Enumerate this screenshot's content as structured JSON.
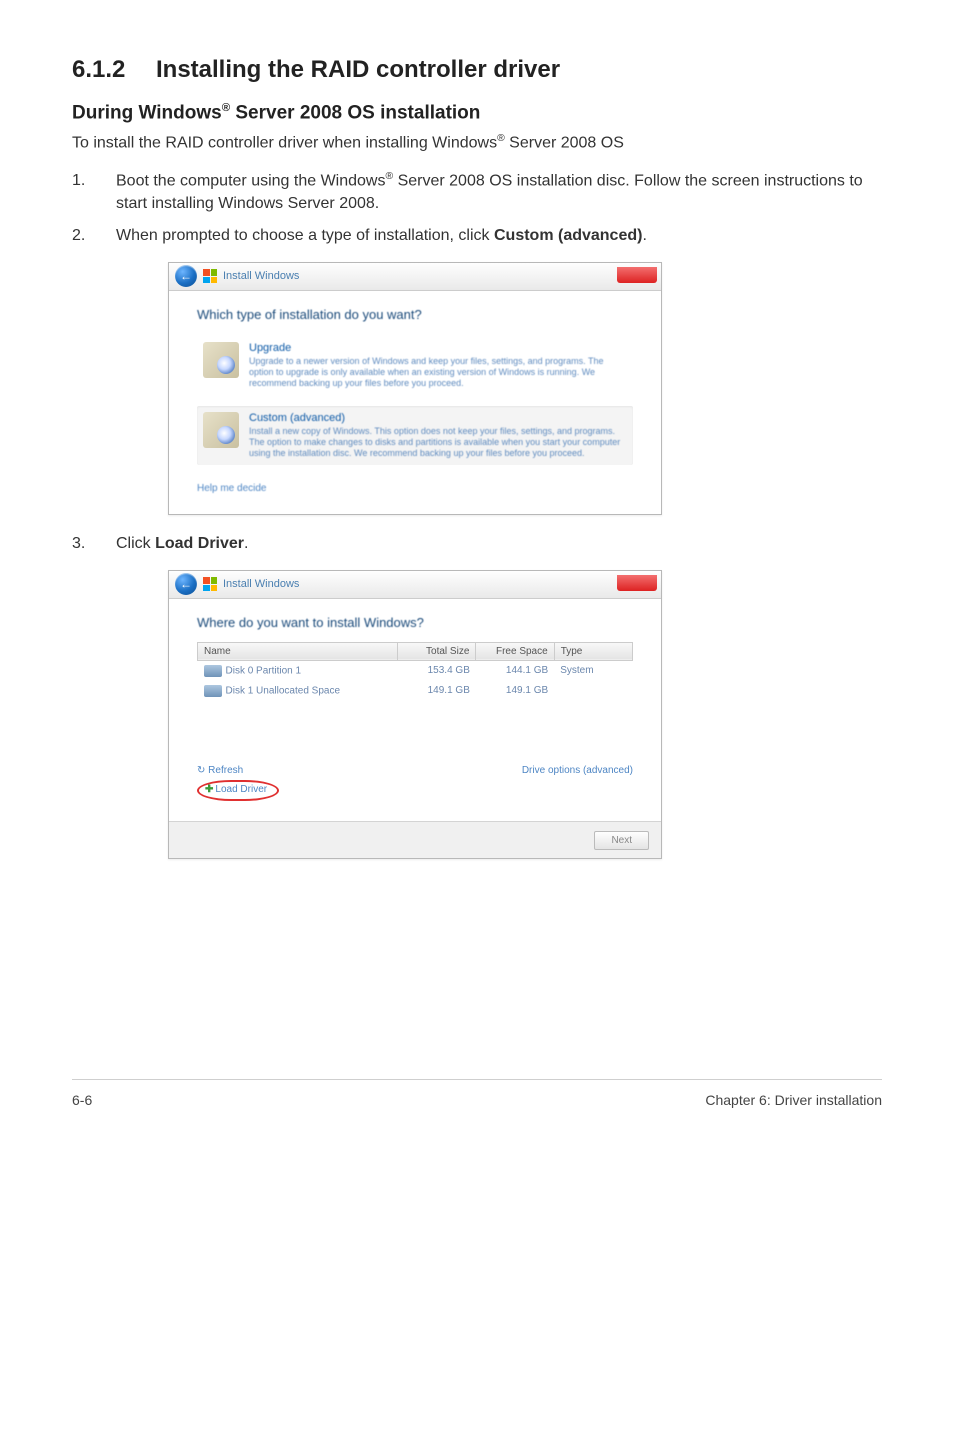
{
  "section": {
    "number": "6.1.2",
    "title": "Installing the RAID controller driver"
  },
  "subsection": {
    "prefix": "During Windows",
    "reg": "®",
    "suffix": " Server 2008 OS installation"
  },
  "intro": {
    "prefix": "To install the RAID controller driver when installing Windows",
    "reg": "®",
    "suffix": " Server 2008 OS"
  },
  "steps": {
    "s1": {
      "num": "1.",
      "line1_prefix": "Boot the computer using the Windows",
      "line1_reg": "®",
      "line1_suffix": " Server 2008 OS installation disc. Follow the screen instructions to start installing Windows Server 2008."
    },
    "s2": {
      "num": "2.",
      "text_prefix": "When prompted to choose a type of installation, click ",
      "bold": "Custom (advanced)",
      "text_suffix": "."
    },
    "s3": {
      "num": "3.",
      "text_prefix": "Click ",
      "bold": "Load Driver",
      "text_suffix": "."
    }
  },
  "dialog1": {
    "titlebar": "Install Windows",
    "heading": "Which type of installation do you want?",
    "opt1_title": "Upgrade",
    "opt1_desc": "Upgrade to a newer version of Windows and keep your files, settings, and programs. The option to upgrade is only available when an existing version of Windows is running. We recommend backing up your files before you proceed.",
    "opt2_title": "Custom (advanced)",
    "opt2_desc": "Install a new copy of Windows. This option does not keep your files, settings, and programs. The option to make changes to disks and partitions is available when you start your computer using the installation disc. We recommend backing up your files before you proceed.",
    "help": "Help me decide"
  },
  "dialog2": {
    "titlebar": "Install Windows",
    "heading": "Where do you want to install Windows?",
    "col_name": "Name",
    "col_total": "Total Size",
    "col_free": "Free Space",
    "col_type": "Type",
    "rows": [
      {
        "name": "Disk 0 Partition 1",
        "total": "153.4 GB",
        "free": "144.1 GB",
        "type": "System"
      },
      {
        "name": "Disk 1 Unallocated Space",
        "total": "149.1 GB",
        "free": "149.1 GB",
        "type": ""
      }
    ],
    "refresh": "Refresh",
    "load_driver": "Load Driver",
    "drive_options": "Drive options (advanced)",
    "next": "Next"
  },
  "footer": {
    "left": "6-6",
    "right": "Chapter 6: Driver installation"
  }
}
